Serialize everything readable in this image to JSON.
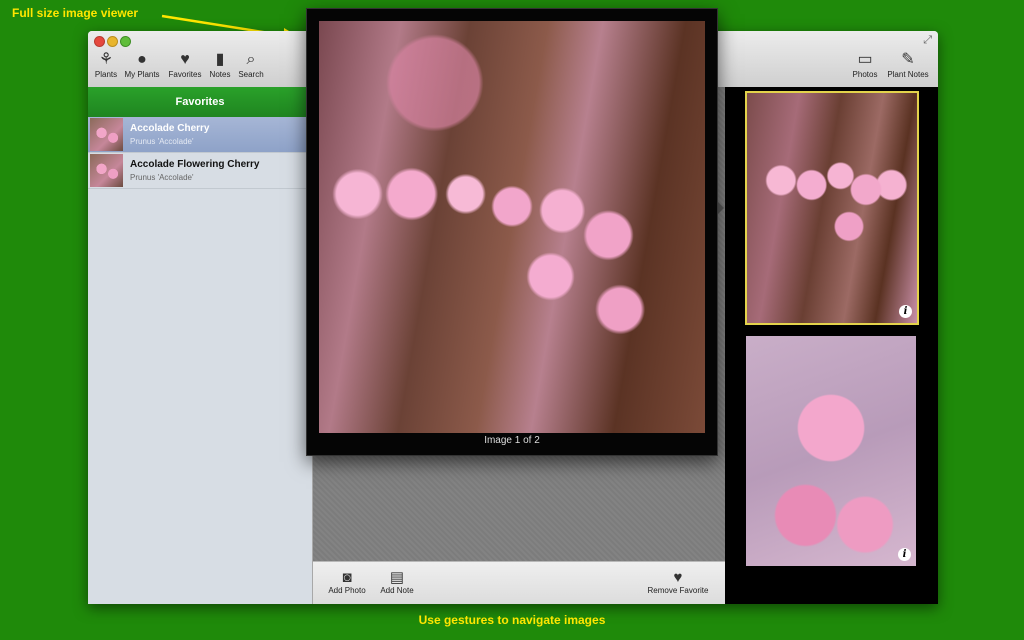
{
  "annotations": {
    "top": "Full size image viewer",
    "bottom": "Use gestures to navigate images"
  },
  "toolbar": {
    "left": [
      {
        "label": "Plants",
        "icon": "plant-pot-icon"
      },
      {
        "label": "My Plants",
        "icon": "person-icon"
      },
      {
        "label": "Favorites",
        "icon": "heart-icon"
      },
      {
        "label": "Notes",
        "icon": "notebook-icon"
      },
      {
        "label": "Search",
        "icon": "magnifier-icon"
      }
    ],
    "right": [
      {
        "label": "Photos",
        "icon": "easel-icon"
      },
      {
        "label": "Plant Notes",
        "icon": "clipboard-icon"
      }
    ]
  },
  "sidebar": {
    "header": "Favorites",
    "items": [
      {
        "title": "Accolade Cherry",
        "subtitle": "Prunus 'Accolade'",
        "selected": true
      },
      {
        "title": "Accolade Flowering Cherry",
        "subtitle": "Prunus 'Accolade'",
        "selected": false
      }
    ]
  },
  "viewer": {
    "caption": "Image 1 of 2"
  },
  "bottombar": {
    "add_photo": "Add Photo",
    "add_note": "Add Note",
    "remove_favorite": "Remove Favorite"
  },
  "colors": {
    "background": "#1f8a0a",
    "annotation": "#ffe600",
    "sidebar_header": "#1f8520",
    "selected_border": "#e3d34b"
  }
}
